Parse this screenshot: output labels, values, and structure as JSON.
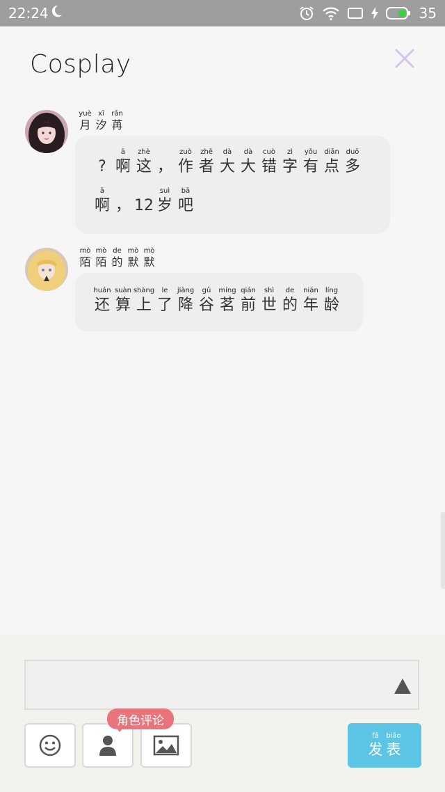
{
  "status_bar": {
    "time": "22:24",
    "battery_level": "35",
    "icons": [
      "moon-icon",
      "alarm-icon",
      "wifi-icon",
      "screen-icon",
      "charging-icon",
      "battery-icon"
    ]
  },
  "header": {
    "title": "Cosplay",
    "close_icon": "close-icon",
    "accent_color": "#d6c3ea"
  },
  "messages": [
    {
      "author": [
        {
          "py": "yuè",
          "hz": "月"
        },
        {
          "py": "xī",
          "hz": "汐"
        },
        {
          "py": "rǎn",
          "hz": "苒"
        }
      ],
      "lines": [
        [
          {
            "py": "",
            "hz": "?"
          },
          {
            "py": "ā",
            "hz": "啊"
          },
          {
            "py": "zhè",
            "hz": "这"
          },
          {
            "py": "",
            "hz": "，"
          },
          {
            "py": "zuò",
            "hz": "作"
          },
          {
            "py": "zhě",
            "hz": "者"
          },
          {
            "py": "dà",
            "hz": "大"
          },
          {
            "py": "dà",
            "hz": "大"
          },
          {
            "py": "cuò",
            "hz": "错"
          },
          {
            "py": "zì",
            "hz": "字"
          },
          {
            "py": "yǒu",
            "hz": "有"
          },
          {
            "py": "diǎn",
            "hz": "点"
          },
          {
            "py": "duō",
            "hz": "多"
          }
        ],
        [
          {
            "py": "ā",
            "hz": "啊"
          },
          {
            "py": "",
            "hz": "，"
          },
          {
            "py": "",
            "hz": "12"
          },
          {
            "py": "suì",
            "hz": "岁"
          },
          {
            "py": "bā",
            "hz": "吧"
          }
        ]
      ]
    },
    {
      "author": [
        {
          "py": "mò",
          "hz": "陌"
        },
        {
          "py": "mò",
          "hz": "陌"
        },
        {
          "py": "de",
          "hz": "的"
        },
        {
          "py": "mò",
          "hz": "默"
        },
        {
          "py": "mò",
          "hz": "默"
        }
      ],
      "lines": [
        [
          {
            "py": "huán",
            "hz": "还"
          },
          {
            "py": "suàn",
            "hz": "算"
          },
          {
            "py": "shàng",
            "hz": "上"
          },
          {
            "py": "le",
            "hz": "了"
          },
          {
            "py": "jiàng",
            "hz": "降"
          },
          {
            "py": "gǔ",
            "hz": "谷"
          },
          {
            "py": "míng",
            "hz": "茗"
          },
          {
            "py": "qián",
            "hz": "前"
          },
          {
            "py": "shì",
            "hz": "世"
          },
          {
            "py": "de",
            "hz": "的"
          },
          {
            "py": "nián",
            "hz": "年"
          },
          {
            "py": "líng",
            "hz": "龄"
          }
        ]
      ]
    }
  ],
  "composer": {
    "input_value": "",
    "send_icon": "triangle-up-icon",
    "tools": [
      "smiley-icon",
      "person-icon",
      "image-icon"
    ],
    "role_comment_tag": "角色评论",
    "publish": [
      {
        "py": "fā",
        "hz": "发"
      },
      {
        "py": "biǎo",
        "hz": "表"
      }
    ],
    "publish_color": "#5cc4e4",
    "tag_color": "#e8747c"
  }
}
